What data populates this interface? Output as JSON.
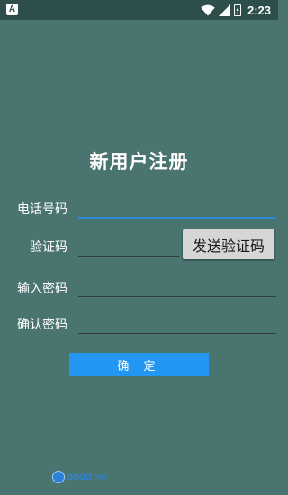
{
  "status_bar": {
    "app_icon": "A",
    "time": "2:23",
    "icons": [
      "wifi-icon",
      "signal-icon",
      "battery-icon"
    ]
  },
  "page_title": "新用户注册",
  "form": {
    "phone": {
      "label": "电话号码",
      "value": "",
      "placeholder": ""
    },
    "code": {
      "label": "验证码",
      "value": "",
      "placeholder": ""
    },
    "send_code_button": "发送验证码",
    "password": {
      "label": "输入密码",
      "value": "",
      "placeholder": ""
    },
    "confirm_password": {
      "label": "确认密码",
      "value": "",
      "placeholder": ""
    },
    "confirm_button": "确 定"
  },
  "watermark": {
    "brand": "GOGO",
    "small": "下载网"
  },
  "colors": {
    "background": "#4a7470",
    "status_bar": "#2e4e4b",
    "accent": "#2196f3",
    "focus_underline": "#2e8ad8"
  }
}
